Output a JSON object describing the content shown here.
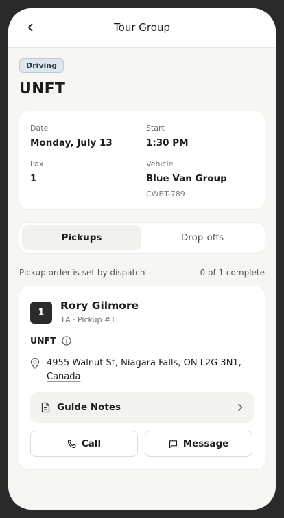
{
  "header": {
    "title": "Tour Group",
    "back_icon": "chevron-left-icon"
  },
  "tour": {
    "badge": "Driving",
    "name": "UNFT"
  },
  "details": {
    "date_label": "Date",
    "date_value": "Monday, July 13",
    "start_label": "Start",
    "start_value": "1:30 PM",
    "pax_label": "Pax",
    "pax_value": "1",
    "vehicle_label": "Vehicle",
    "vehicle_value": "Blue Van Group",
    "vehicle_plate": "CWBT-789"
  },
  "tabs": [
    {
      "label": "Pickups",
      "active": true
    },
    {
      "label": "Drop-offs",
      "active": false
    }
  ],
  "order": {
    "note": "Pickup order is set by dispatch",
    "progress": "0 of 1 complete"
  },
  "pickup": {
    "number": "1",
    "name": "Rory Gilmore",
    "meta": "1A · Pickup #1",
    "tour_code": "UNFT",
    "address_line1": "4955 Walnut St, Niagara Falls, ON L2G 3N1,",
    "address_line2": "Canada",
    "notes_label": "Guide Notes",
    "call_label": "Call",
    "message_label": "Message"
  },
  "colors": {
    "badge_bg": "#dfe7ee",
    "badge_border": "#b9c9d7",
    "number_bg": "#2b2b2b"
  }
}
